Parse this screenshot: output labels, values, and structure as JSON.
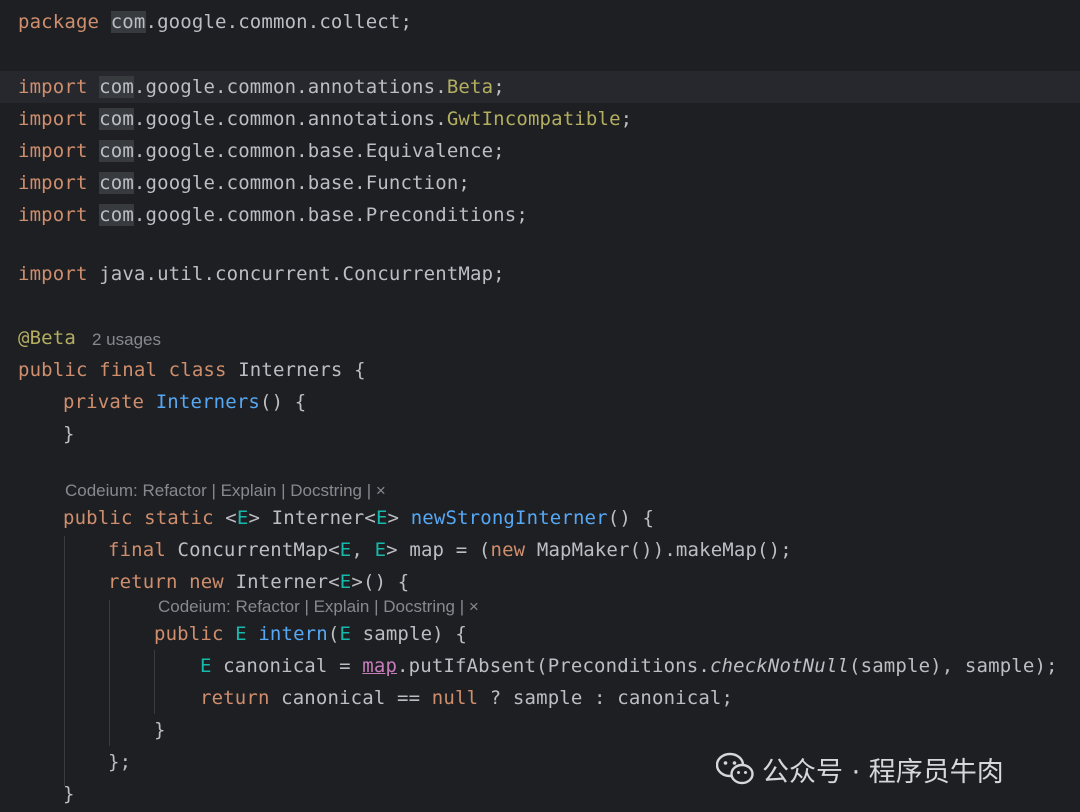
{
  "code": {
    "package_kw": "package",
    "package_com": "com",
    "package_rest": ".google.common.collect;",
    "import_kw": "import",
    "com": "com",
    "imp1_mid": ".google.common.annotations.",
    "imp1_cls": "Beta",
    "imp2_mid": ".google.common.annotations.",
    "imp2_cls": "GwtIncompatible",
    "imp3_rest": ".google.common.base.Equivalence;",
    "imp4_rest": ".google.common.base.Function;",
    "imp5_rest": ".google.common.base.Preconditions;",
    "imp6_rest": "java.util.concurrent.ConcurrentMap;",
    "semicolon": ";",
    "annotation": "@Beta",
    "usages": "2 usages",
    "class_mods": "public final class ",
    "class_name": "Interners {",
    "ctor_mod": "private ",
    "ctor_name": "Interners",
    "ctor_rest": "() {",
    "close_brace": "}",
    "codeium_hint": "Codeium: Refactor | Explain | Docstring | ×",
    "m_public_static": "public static ",
    "lt": "<",
    "type_e": "E",
    "gt_space": "> ",
    "interner_lt": "Interner<",
    "method_name": "newStrongInterner",
    "method_rest": "() {",
    "final_kw": "final ",
    "cm_lt": "ConcurrentMap<",
    "comma_space": ", ",
    "map_assign": "> map = (",
    "new_kw": "new",
    "mapmaker_rest": " MapMaker()).makeMap();",
    "return_kw": "return ",
    "new_kw2": "new ",
    "anon_rest": ">() {",
    "public_kw": "public ",
    "intern_name": "intern",
    "paren_open": "(",
    "sample_rest": " sample) {",
    "canonical_decl": " canonical = ",
    "map_field": "map",
    "put_rest": ".putIfAbsent(Preconditions.",
    "check_not_null": "checkNotNull",
    "put_tail": "(sample), sample);",
    "ret_canonical": "canonical == ",
    "null_kw": "null",
    "ternary_rest": " ? sample : canonical;",
    "anon_close": "};"
  },
  "watermark": {
    "icon": "wechat-icon",
    "text": "公众号 · 程序员牛肉"
  }
}
